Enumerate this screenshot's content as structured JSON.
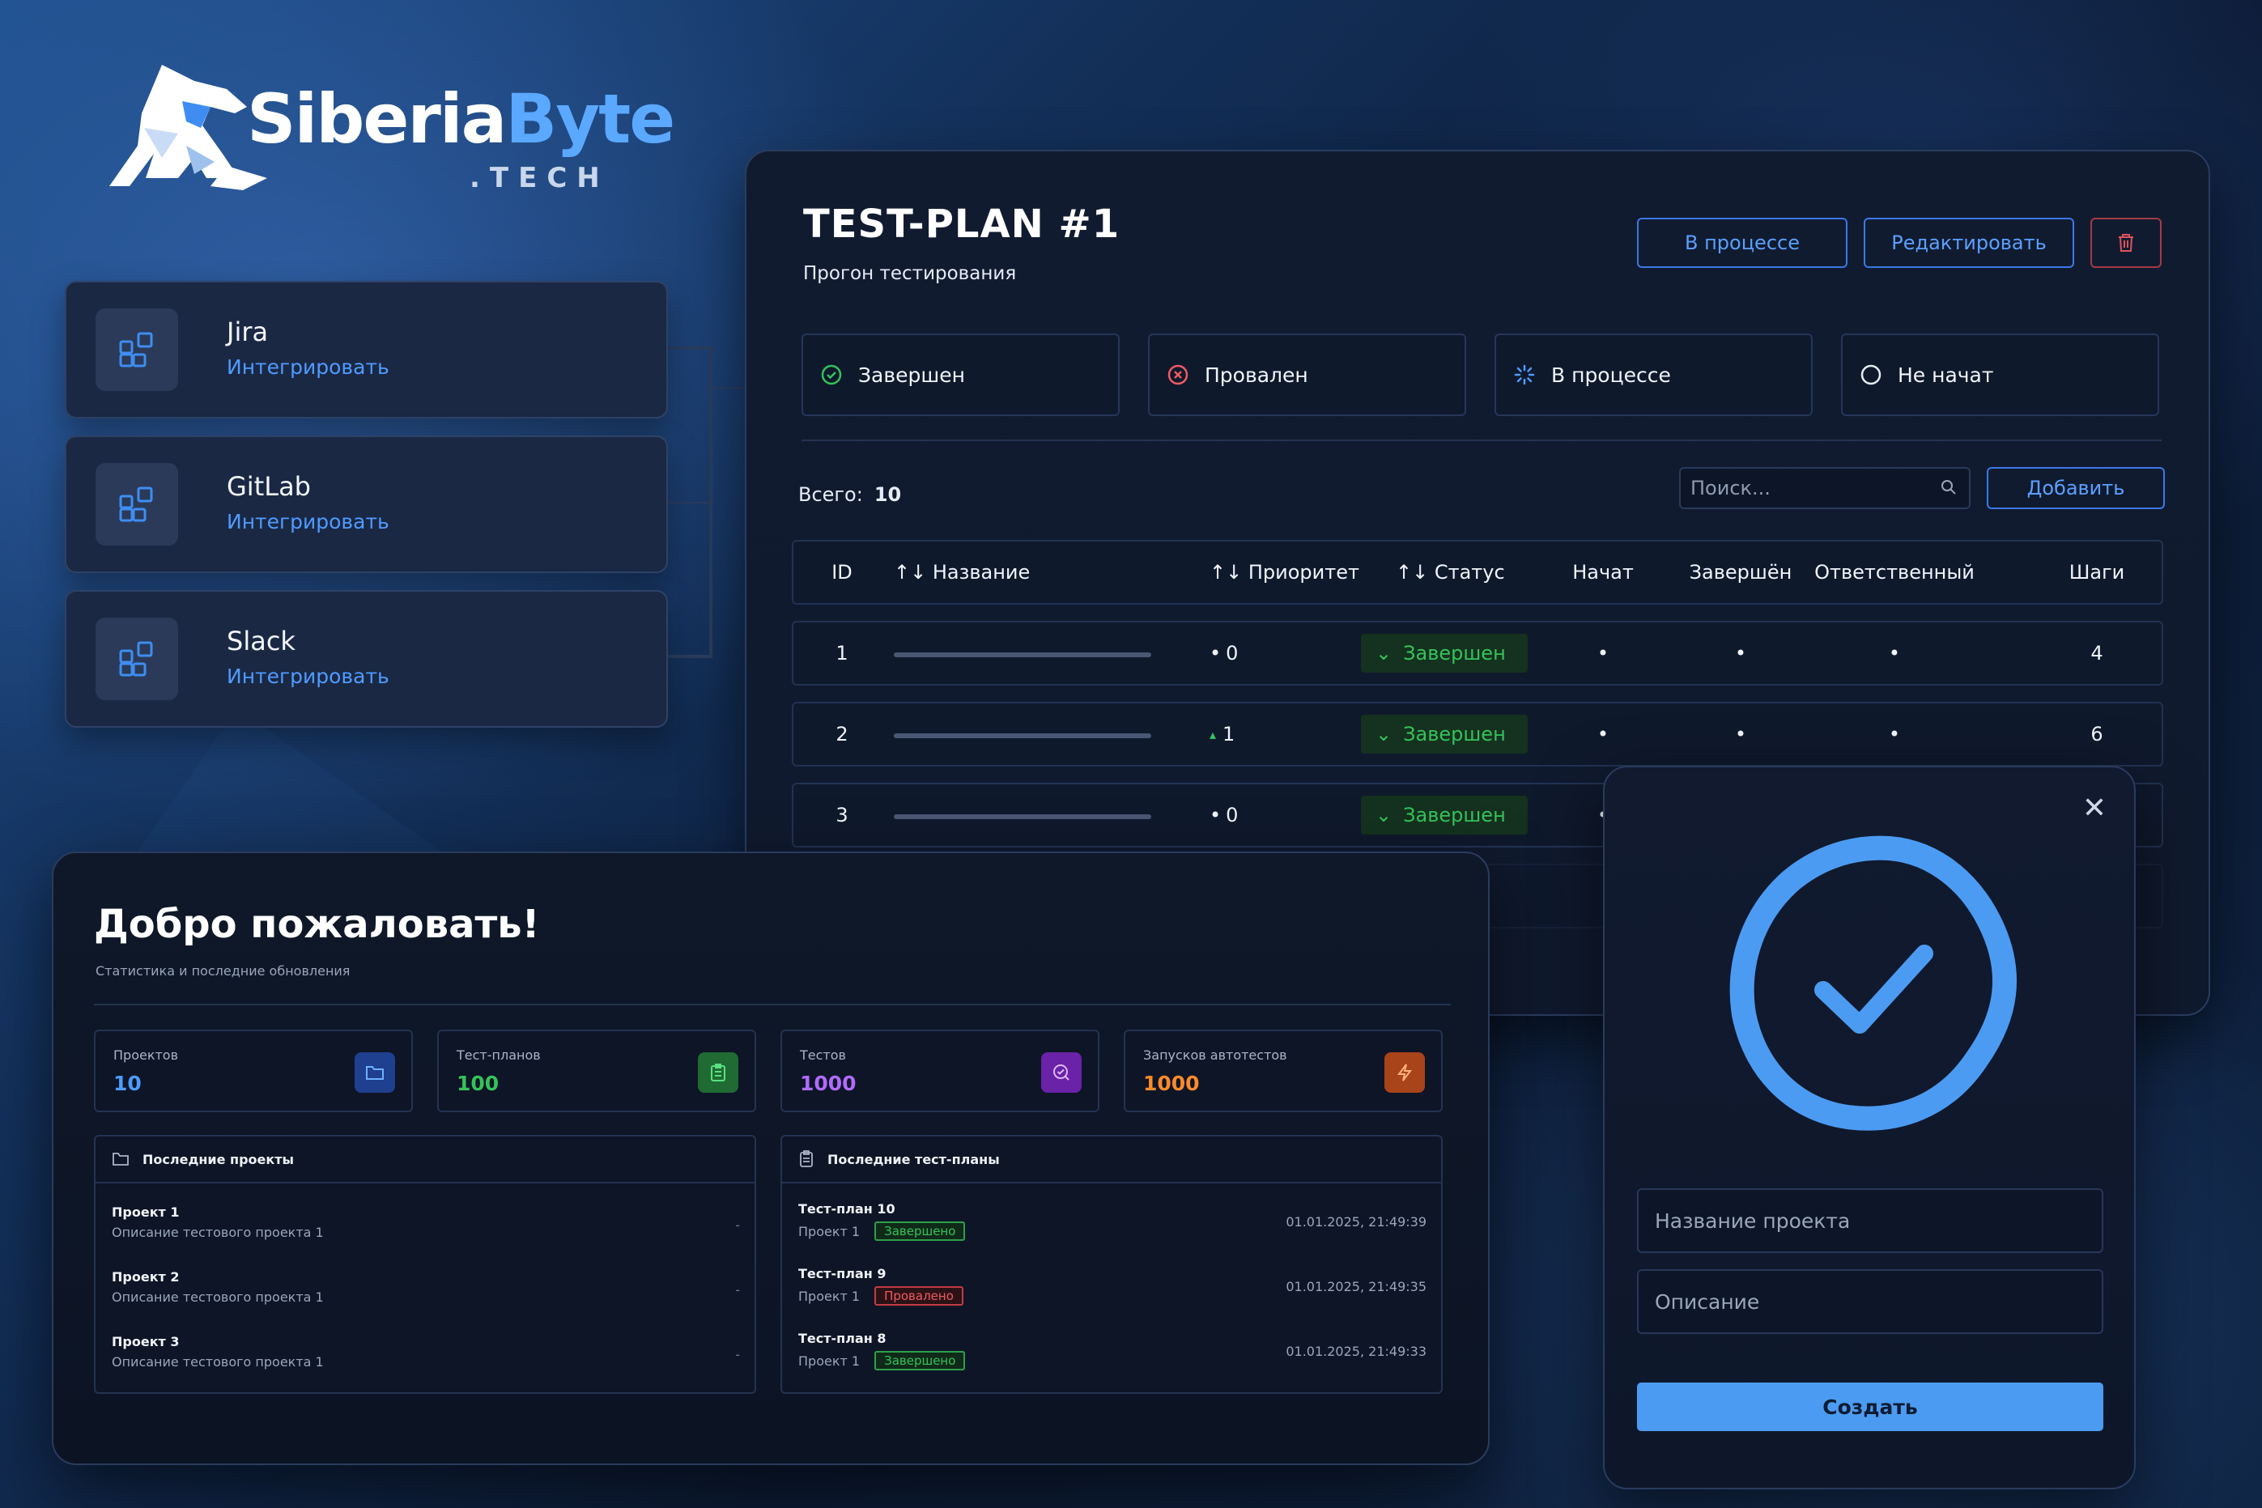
{
  "brand": {
    "name_part1": "Siberia",
    "name_part2": "Byte",
    "suffix": ".TECH"
  },
  "integrations": [
    {
      "name": "Jira",
      "action": "Интегрировать"
    },
    {
      "name": "GitLab",
      "action": "Интегрировать"
    },
    {
      "name": "Slack",
      "action": "Интегрировать"
    }
  ],
  "test_plan": {
    "title": "TEST-PLAN #1",
    "subtitle": "Прогон тестирования",
    "buttons": {
      "status": "В процессе",
      "edit": "Редактировать"
    },
    "status_filters": [
      {
        "label": "Завершен",
        "icon": "check-circle-icon",
        "color": "#35c25a"
      },
      {
        "label": "Провален",
        "icon": "x-circle-icon",
        "color": "#ef5a62"
      },
      {
        "label": "В процессе",
        "icon": "spinner-icon",
        "color": "#4f9bff"
      },
      {
        "label": "Не начат",
        "icon": "empty-circle-icon",
        "color": "#e6ecf5"
      }
    ],
    "total_label": "Всего:",
    "total_value": "10",
    "search_placeholder": "Поиск...",
    "add_button": "Добавить",
    "columns": [
      "ID",
      "↑↓ Название",
      "↑↓ Приоритет",
      "↑↓ Статус",
      "Начат",
      "Завершён",
      "Ответственный",
      "Шаги"
    ],
    "rows": [
      {
        "id": "1",
        "priority": "0",
        "priority_marker": "•",
        "status": "Завершен",
        "started": "•",
        "finished": "•",
        "owner": "•",
        "steps": "4"
      },
      {
        "id": "2",
        "priority": "1",
        "priority_marker": "▴",
        "status": "Завершен",
        "started": "•",
        "finished": "•",
        "owner": "•",
        "steps": "6"
      },
      {
        "id": "3",
        "priority": "0",
        "priority_marker": "•",
        "status": "Завершен",
        "started": "•",
        "finished": "•",
        "owner": "•",
        "steps": ""
      }
    ]
  },
  "welcome": {
    "title": "Добро пожаловать!",
    "subtitle": "Статистика и последние обновления",
    "stats": [
      {
        "label": "Проектов",
        "value": "10",
        "color": "#4f9bff",
        "icon": "folder-icon",
        "icon_bg": "#1f3f8f"
      },
      {
        "label": "Тест-планов",
        "value": "100",
        "color": "#35c25a",
        "icon": "clipboard-icon",
        "icon_bg": "#1f6b33"
      },
      {
        "label": "Тестов",
        "value": "1000",
        "color": "#b06bff",
        "icon": "search-check-icon",
        "icon_bg": "#6a22a8"
      },
      {
        "label": "Запусков автотестов",
        "value": "1000",
        "color": "#ff8a2a",
        "icon": "lightning-icon",
        "icon_bg": "#a8431a"
      }
    ],
    "recent_projects": {
      "title": "Последние проекты",
      "items": [
        {
          "name": "Проект 1",
          "desc": "Описание тестового проекта 1",
          "meta": "-"
        },
        {
          "name": "Проект 2",
          "desc": "Описание тестового проекта 1",
          "meta": "-"
        },
        {
          "name": "Проект 3",
          "desc": "Описание тестового проекта 1",
          "meta": "-"
        }
      ]
    },
    "recent_plans": {
      "title": "Последние тест-планы",
      "items": [
        {
          "name": "Тест-план 10",
          "project": "Проект 1",
          "status": "Завершено",
          "time": "01.01.2025, 21:49:39"
        },
        {
          "name": "Тест-план 9",
          "project": "Проект 1",
          "status": "Провалено",
          "time": "01.01.2025, 21:49:35"
        },
        {
          "name": "Тест-план 8",
          "project": "Проект 1",
          "status": "Завершено",
          "time": "01.01.2025, 21:49:33"
        }
      ]
    }
  },
  "modal": {
    "name_placeholder": "Название проекта",
    "desc_placeholder": "Описание",
    "create_button": "Создать"
  }
}
